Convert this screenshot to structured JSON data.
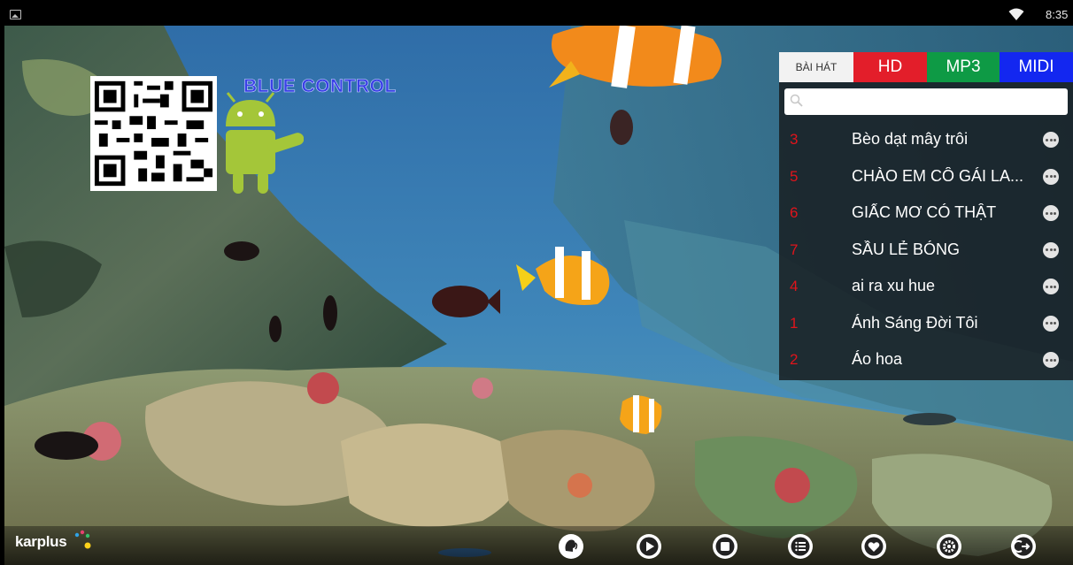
{
  "status_bar": {
    "time": "8:35",
    "icons": [
      "image-icon",
      "wifi-icon"
    ]
  },
  "overlay": {
    "qr_label": "BLUE CONTROL",
    "icons": [
      "qr-code-icon",
      "android-icon"
    ]
  },
  "song_panel": {
    "tabs": [
      {
        "label": "BÀI HÁT",
        "color": "#f2f2f2"
      },
      {
        "label": "HD",
        "color": "#e31e2a"
      },
      {
        "label": "MP3",
        "color": "#0e9a45"
      },
      {
        "label": "MIDI",
        "color": "#1327f0"
      }
    ],
    "search": {
      "placeholder": "",
      "icon": "search-icon"
    },
    "songs": [
      {
        "num": "3",
        "title": "Bèo dạt mây trôi"
      },
      {
        "num": "5",
        "title": "CHÀO EM CÔ GÁI LA..."
      },
      {
        "num": "6",
        "title": "GIẤC MƠ CÓ THẬT"
      },
      {
        "num": "7",
        "title": "SẦU LẺ BÓNG"
      },
      {
        "num": "4",
        "title": "ai ra xu hue"
      },
      {
        "num": "1",
        "title": "Ánh Sáng Đời Tôi"
      },
      {
        "num": "2",
        "title": "Áo hoa"
      }
    ]
  },
  "bottom_bar": {
    "logo_text": "karplus",
    "controls": [
      "vocal-icon",
      "play-icon",
      "stop-icon",
      "playlist-icon",
      "favorite-icon",
      "settings-icon",
      "exit-icon"
    ]
  },
  "colors": {
    "song_number": "#e0141b",
    "panel_bg": "#181e22"
  }
}
